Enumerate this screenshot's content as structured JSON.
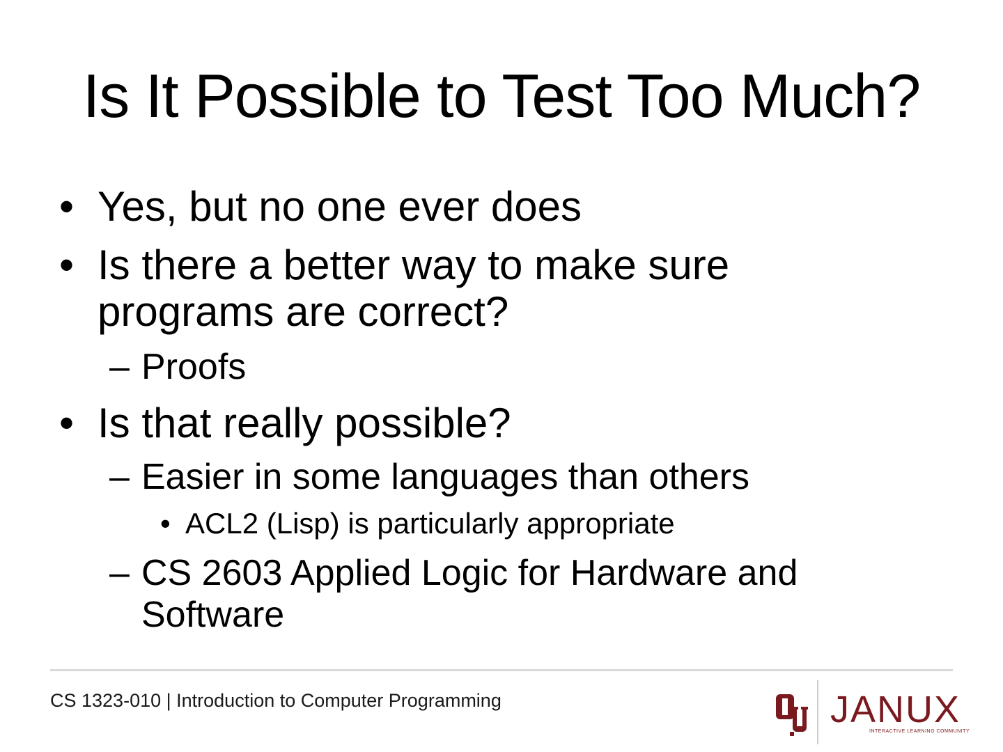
{
  "slide": {
    "title": "Is It Possible to Test Too Much?",
    "bullets": {
      "b1": {
        "marker": "•",
        "text": "Yes, but no one ever does"
      },
      "b2": {
        "marker": "•",
        "line1": "Is there a better way to make sure",
        "line2": "programs are correct?"
      },
      "b2_1": {
        "marker": "–",
        "text": "Proofs"
      },
      "b3": {
        "marker": "•",
        "text": "Is that really possible?"
      },
      "b3_1": {
        "marker": "–",
        "text": "Easier in some languages than others"
      },
      "b3_1_1": {
        "marker": "•",
        "text": "ACL2 (Lisp) is particularly appropriate"
      },
      "b3_2": {
        "marker": "–",
        "line1": "CS 2603 Applied Logic for Hardware and",
        "line2": "Software"
      }
    }
  },
  "footer": {
    "course": "CS 1323-010 | Introduction to Computer Programming",
    "logo": {
      "ou_icon": "ou-monogram-icon",
      "brand": "JANUX",
      "tagline": "INTERACTIVE LEARNING COMMUNITY",
      "color": "#7a1a1f"
    }
  }
}
